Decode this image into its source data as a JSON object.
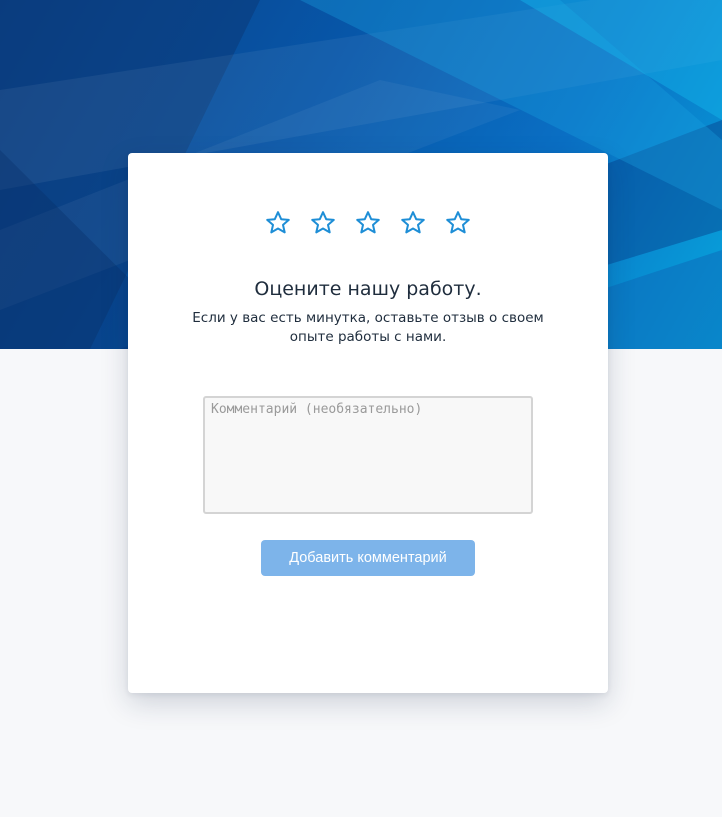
{
  "rating": {
    "stars": [
      {
        "name": "star-1",
        "icon": "star-outline-icon"
      },
      {
        "name": "star-2",
        "icon": "star-outline-icon"
      },
      {
        "name": "star-3",
        "icon": "star-outline-icon"
      },
      {
        "name": "star-4",
        "icon": "star-outline-icon"
      },
      {
        "name": "star-5",
        "icon": "star-outline-icon"
      }
    ],
    "selected": 0,
    "max": 5,
    "star_color": "#1e8ed6"
  },
  "heading": {
    "title": "Оцените нашу работу.",
    "subtitle": "Если у вас есть минутка, оставьте отзыв о своем опыте работы с нами."
  },
  "comment": {
    "value": "",
    "placeholder": "Комментарий (необязательно)"
  },
  "submit": {
    "label": "Добавить комментарий",
    "color": "#7db4ea"
  },
  "theme": {
    "hero_color": "#0756a8",
    "page_background": "#f7f8fa"
  }
}
